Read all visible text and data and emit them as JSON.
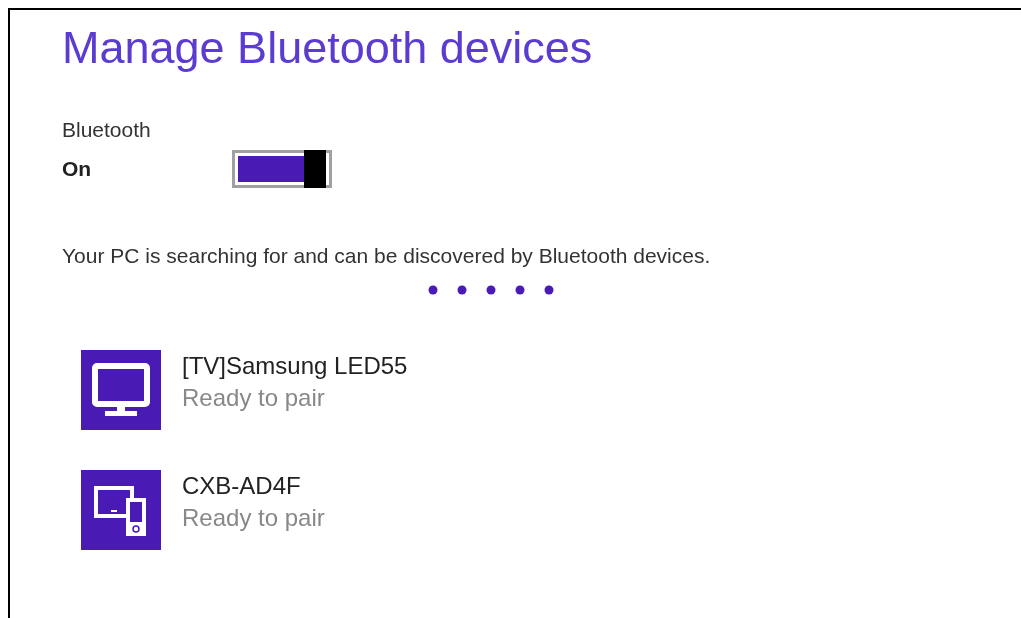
{
  "title": "Manage Bluetooth devices",
  "bluetooth": {
    "label": "Bluetooth",
    "state_text": "On",
    "on": true
  },
  "status": "Your PC is searching for and can be discovered by Bluetooth devices.",
  "devices": [
    {
      "kind": "tv",
      "name": "[TV]Samsung LED55",
      "status": "Ready to pair"
    },
    {
      "kind": "multi",
      "name": "CXB-AD4F",
      "status": "Ready to pair"
    }
  ]
}
